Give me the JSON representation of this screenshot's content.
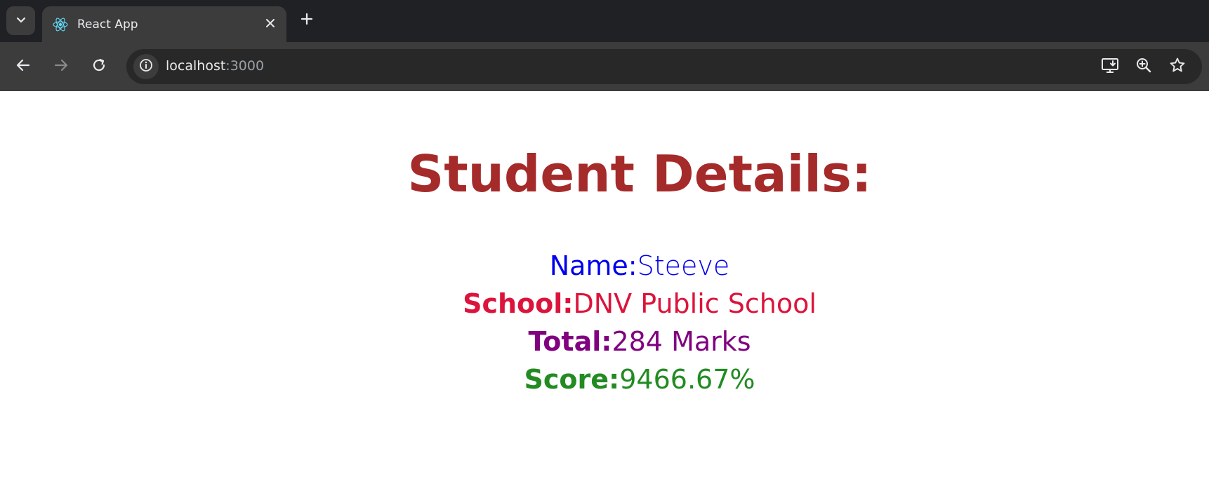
{
  "browser": {
    "tab": {
      "title": "React App"
    },
    "address": {
      "host": "localhost",
      "port": ":3000"
    },
    "colors": {
      "chrome_dark": "#202124",
      "chrome_mid": "#3c3c3c",
      "omnibox": "#282828"
    }
  },
  "content": {
    "heading": "Student Details:",
    "fields": {
      "name": {
        "label": "Name:",
        "value": "Steeve",
        "color": "#0000ee"
      },
      "school": {
        "label": "School:",
        "value": "DNV Public School",
        "color": "#dc143c"
      },
      "total": {
        "label": "Total:",
        "value": "284 Marks",
        "color": "#800080"
      },
      "score": {
        "label": "Score:",
        "value": "9466.67%",
        "color": "#228b22"
      }
    },
    "heading_color": "#a52a2a"
  }
}
